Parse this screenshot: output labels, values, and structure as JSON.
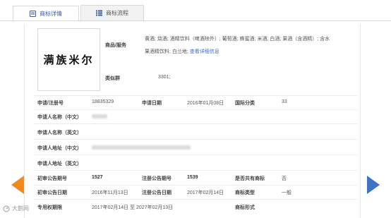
{
  "tabs": [
    {
      "label": "商标详情",
      "icon": "document-icon"
    },
    {
      "label": "商标流程",
      "icon": "list-icon"
    }
  ],
  "trademark": {
    "mark_text": "满族米尔",
    "goods_label": "商品/服务",
    "goods_line1": "黄酒; 烧酒; 酒精饮料（啤酒除外）; 葡萄酒; 蜂蜜酒; 米酒; 白酒; 果酒（含酒精）; 含水",
    "goods_line2": "果酒精饮料; 白兰地;",
    "goods_link": "查看详细信息",
    "class_label": "类似群",
    "class_value": "3301;"
  },
  "fields": {
    "reg_no_label": "申请/注册号",
    "reg_no": "18835329",
    "app_date_label": "申请日期",
    "app_date": "2016年01月08日",
    "intl_class_label": "国际分类",
    "intl_class": "33",
    "applicant_cn_label": "申请人名称（中文）",
    "applicant_en_label": "申请人名称（英文）",
    "address_cn_label": "申请人地址（中文）",
    "address_en_label": "申请人地址（英文）",
    "prelim_no_label": "初审公告期号",
    "prelim_no": "1527",
    "reg_pub_no_label": "注册公告期号",
    "reg_pub_no": "1539",
    "shared_label": "是否共有商标",
    "shared": "否",
    "prelim_date_label": "初审公告日期",
    "prelim_date": "2016年11月13日",
    "reg_pub_date_label": "注册公告日期",
    "reg_pub_date": "2017年02月14日",
    "mark_type_label": "商标类型",
    "mark_type": "一般",
    "exclusive_label": "专用权期限",
    "exclusive": "2017年02月14日 至 2027年02月13日",
    "mark_form_label": "商标形式"
  },
  "watermark": {
    "logo_text": "大鹅网"
  },
  "colors": {
    "accent": "#3b5ba9",
    "link": "#3a6fd8",
    "prev_arrow": "#f08a1c",
    "next_arrow": "#3f73c6"
  }
}
